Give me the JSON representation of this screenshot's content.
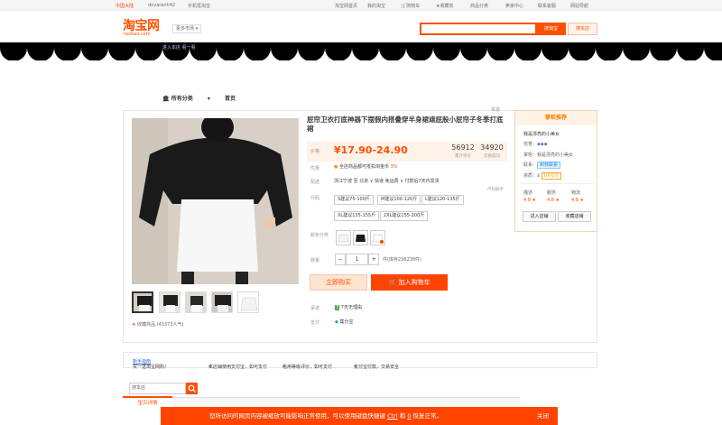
{
  "topbar": {
    "region": "中国大陆",
    "user": "dovaranh42",
    "mobile": "手机逛淘宝",
    "links": [
      "淘宝网首页",
      "我的淘宝",
      "购物车",
      "收藏夹",
      "商品分类",
      "卖家中心",
      "联系客服",
      "网站导航"
    ]
  },
  "header": {
    "logo": "淘宝网",
    "logo_sub": "taobao.com",
    "market": "更多市场",
    "search_value": "",
    "search_button": "搜淘宝",
    "search_shop_button": "搜本店",
    "banner_link": "进入本店 看一看"
  },
  "nav": {
    "all_categories": "所有分类",
    "home": "首页"
  },
  "product": {
    "report": "举报",
    "title": "屁帘卫衣打底神器下摆假内搭叠穿半身裙遮屁股小屁帘子冬季打底裙",
    "price_label": "价格",
    "price": "¥17.90-24.90",
    "reviews_count": "56912",
    "reviews_label": "累计评论",
    "sales_count": "34920",
    "sales_label": "交易成功",
    "promo_label": "优惠",
    "promo_text": "全店商品都可抵扣淘金币",
    "promo_pct": "3%",
    "shipping_label": "配送",
    "shipping_text": "浙江宁波 至 北京  ∨  快递 免运费 ∨  付款后7天内发货",
    "size_label": "尺码",
    "size_chart": "尺码助手",
    "sizes": [
      "S建议75-100斤",
      "M建议100-120斤",
      "L建议120-135斤",
      "XL建议135-155斤",
      "2XL建议155-200斤"
    ],
    "color_label": "颜色分类",
    "qty_label": "数量",
    "qty_value": "1",
    "qty_minus": "−",
    "qty_plus": "+",
    "stock": "件(库存236238件)",
    "buy_now": "立即购买",
    "add_cart": "加入购物车",
    "promise_label": "承诺",
    "promise_text": "7天无理由",
    "payment_label": "支付",
    "payment_text": "集分宝",
    "favorite": "收藏商品 (43373人气)"
  },
  "seller": {
    "header": "掌柜推荐",
    "shop_name": "我是漂亮的小美女",
    "credit_label": "信誉：",
    "owner_label": "掌柜：",
    "owner_name": "我是漂亮的小美女",
    "contact_label": "联系：",
    "contact_badge": "和我联系",
    "qualify_label": "资质：",
    "deposit": "1000元",
    "metrics": [
      {
        "label": "描述",
        "value": "4.8 ★"
      },
      {
        "label": "服务",
        "value": "4.8 ★"
      },
      {
        "label": "物流",
        "value": "4.8 ★"
      }
    ],
    "enter_shop": "进入店铺",
    "fav_shop": "收藏店铺"
  },
  "guarantee": {
    "items": [
      "买一送淘宝网购！",
      "新手指南",
      "本店铺使用支付宝，如可支付",
      "信用等级评价，如可支付",
      "支付宝付款，交易安全"
    ]
  },
  "shop_search": {
    "placeholder": "搜本店"
  },
  "tabs": {
    "active": "宝贝详情"
  },
  "notice": {
    "text_before": "您所访问的网页内容被缩放可能影响正常使用，可以使用键盘快捷键",
    "key1": "Ctrl",
    "and": "和",
    "key2": "0",
    "text_after": "恢复正常。",
    "close": "关闭"
  },
  "colors": {
    "accent": "#ff5000",
    "cart": "#ff4400"
  }
}
